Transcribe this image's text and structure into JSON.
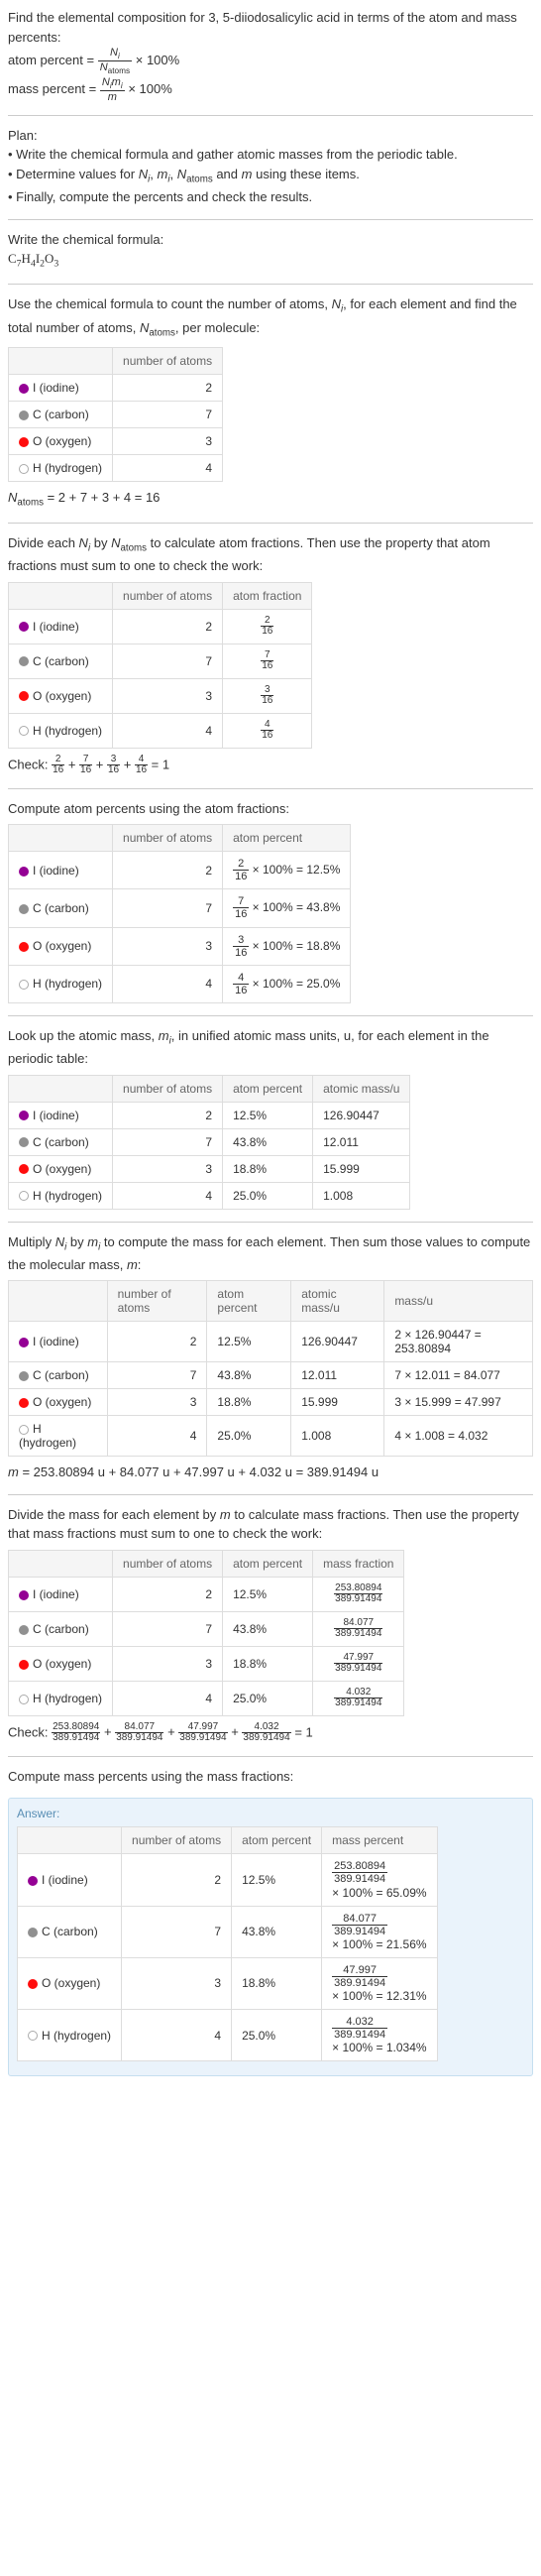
{
  "intro": {
    "title": "Find the elemental composition for 3, 5-diiodosalicylic acid in terms of the atom and mass percents:",
    "atom_percent_label": "atom percent =",
    "atom_percent_formula_num": "N_i",
    "atom_percent_formula_den": "N_atoms",
    "times100": "× 100%",
    "mass_percent_label": "mass percent =",
    "mass_percent_formula_num": "N_i m_i",
    "mass_percent_formula_den": "m"
  },
  "plan": {
    "heading": "Plan:",
    "b1": "• Write the chemical formula and gather atomic masses from the periodic table.",
    "b2_prefix": "• Determine values for ",
    "b2_terms": "N_i, m_i, N_atoms and m",
    "b2_suffix": " using these items.",
    "b3": "• Finally, compute the percents and check the results."
  },
  "formula_sec": {
    "heading": "Write the chemical formula:",
    "formula": "C₇H₄I₂O₃"
  },
  "count_sec": {
    "heading_pre": "Use the chemical formula to count the number of atoms, ",
    "heading_mid": ", for each element and find the total number of atoms, ",
    "heading_suf": ", per molecule:",
    "ni": "N_i",
    "natoms": "N_atoms",
    "col1": "",
    "col2": "number of atoms",
    "rows": [
      {
        "swatch": "iodine",
        "name": "I (iodine)",
        "n": "2"
      },
      {
        "swatch": "carbon",
        "name": "C (carbon)",
        "n": "7"
      },
      {
        "swatch": "oxygen",
        "name": "O (oxygen)",
        "n": "3"
      },
      {
        "swatch": "hydrogen",
        "name": "H (hydrogen)",
        "n": "4"
      }
    ],
    "total": "N_atoms = 2 + 7 + 3 + 4 = 16"
  },
  "atomfrac_sec": {
    "heading": "Divide each N_i by N_atoms to calculate atom fractions. Then use the property that atom fractions must sum to one to check the work:",
    "col2": "number of atoms",
    "col3": "atom fraction",
    "rows": [
      {
        "swatch": "iodine",
        "name": "I (iodine)",
        "n": "2",
        "fnum": "2",
        "fden": "16"
      },
      {
        "swatch": "carbon",
        "name": "C (carbon)",
        "n": "7",
        "fnum": "7",
        "fden": "16"
      },
      {
        "swatch": "oxygen",
        "name": "O (oxygen)",
        "n": "3",
        "fnum": "3",
        "fden": "16"
      },
      {
        "swatch": "hydrogen",
        "name": "H (hydrogen)",
        "n": "4",
        "fnum": "4",
        "fden": "16"
      }
    ],
    "check_label": "Check: ",
    "check_eq": "2/16 + 7/16 + 3/16 + 4/16 = 1"
  },
  "atompct_sec": {
    "heading": "Compute atom percents using the atom fractions:",
    "col2": "number of atoms",
    "col3": "atom percent",
    "rows": [
      {
        "swatch": "iodine",
        "name": "I (iodine)",
        "n": "2",
        "fnum": "2",
        "fden": "16",
        "pct": "12.5%"
      },
      {
        "swatch": "carbon",
        "name": "C (carbon)",
        "n": "7",
        "fnum": "7",
        "fden": "16",
        "pct": "43.8%"
      },
      {
        "swatch": "oxygen",
        "name": "O (oxygen)",
        "n": "3",
        "fnum": "3",
        "fden": "16",
        "pct": "18.8%"
      },
      {
        "swatch": "hydrogen",
        "name": "H (hydrogen)",
        "n": "4",
        "fnum": "4",
        "fden": "16",
        "pct": "25.0%"
      }
    ]
  },
  "atomicmass_sec": {
    "heading": "Look up the atomic mass, m_i, in unified atomic mass units, u, for each element in the periodic table:",
    "col2": "number of atoms",
    "col3": "atom percent",
    "col4": "atomic mass/u",
    "rows": [
      {
        "swatch": "iodine",
        "name": "I (iodine)",
        "n": "2",
        "pct": "12.5%",
        "mass": "126.90447"
      },
      {
        "swatch": "carbon",
        "name": "C (carbon)",
        "n": "7",
        "pct": "43.8%",
        "mass": "12.011"
      },
      {
        "swatch": "oxygen",
        "name": "O (oxygen)",
        "n": "3",
        "pct": "18.8%",
        "mass": "15.999"
      },
      {
        "swatch": "hydrogen",
        "name": "H (hydrogen)",
        "n": "4",
        "pct": "25.0%",
        "mass": "1.008"
      }
    ]
  },
  "molmass_sec": {
    "heading": "Multiply N_i by m_i to compute the mass for each element. Then sum those values to compute the molecular mass, m:",
    "col2": "number of atoms",
    "col3": "atom percent",
    "col4": "atomic mass/u",
    "col5": "mass/u",
    "rows": [
      {
        "swatch": "iodine",
        "name": "I (iodine)",
        "n": "2",
        "pct": "12.5%",
        "mass": "126.90447",
        "calc": "2 × 126.90447 = 253.80894"
      },
      {
        "swatch": "carbon",
        "name": "C (carbon)",
        "n": "7",
        "pct": "43.8%",
        "mass": "12.011",
        "calc": "7 × 12.011 = 84.077"
      },
      {
        "swatch": "oxygen",
        "name": "O (oxygen)",
        "n": "3",
        "pct": "18.8%",
        "mass": "15.999",
        "calc": "3 × 15.999 = 47.997"
      },
      {
        "swatch": "hydrogen",
        "name": "H (hydrogen)",
        "n": "4",
        "pct": "25.0%",
        "mass": "1.008",
        "calc": "4 × 1.008 = 4.032"
      }
    ],
    "total": "m = 253.80894 u + 84.077 u + 47.997 u + 4.032 u = 389.91494 u"
  },
  "massfrac_sec": {
    "heading": "Divide the mass for each element by m to calculate mass fractions. Then use the property that mass fractions must sum to one to check the work:",
    "col2": "number of atoms",
    "col3": "atom percent",
    "col4": "mass fraction",
    "rows": [
      {
        "swatch": "iodine",
        "name": "I (iodine)",
        "n": "2",
        "pct": "12.5%",
        "fnum": "253.80894",
        "fden": "389.91494"
      },
      {
        "swatch": "carbon",
        "name": "C (carbon)",
        "n": "7",
        "pct": "43.8%",
        "fnum": "84.077",
        "fden": "389.91494"
      },
      {
        "swatch": "oxygen",
        "name": "O (oxygen)",
        "n": "3",
        "pct": "18.8%",
        "fnum": "47.997",
        "fden": "389.91494"
      },
      {
        "swatch": "hydrogen",
        "name": "H (hydrogen)",
        "n": "4",
        "pct": "25.0%",
        "fnum": "4.032",
        "fden": "389.91494"
      }
    ],
    "check_label": "Check: ",
    "check_terms": [
      {
        "num": "253.80894",
        "den": "389.91494"
      },
      {
        "num": "84.077",
        "den": "389.91494"
      },
      {
        "num": "47.997",
        "den": "389.91494"
      },
      {
        "num": "4.032",
        "den": "389.91494"
      }
    ],
    "check_eq_suffix": " = 1"
  },
  "masspct_sec": {
    "heading": "Compute mass percents using the mass fractions:"
  },
  "answer": {
    "label": "Answer:",
    "col2": "number of atoms",
    "col3": "atom percent",
    "col4": "mass percent",
    "rows": [
      {
        "swatch": "iodine",
        "name": "I (iodine)",
        "n": "2",
        "pct": "12.5%",
        "fnum": "253.80894",
        "fden": "389.91494",
        "result": "× 100% = 65.09%"
      },
      {
        "swatch": "carbon",
        "name": "C (carbon)",
        "n": "7",
        "pct": "43.8%",
        "fnum": "84.077",
        "fden": "389.91494",
        "result": "× 100% = 21.56%"
      },
      {
        "swatch": "oxygen",
        "name": "O (oxygen)",
        "n": "3",
        "pct": "18.8%",
        "fnum": "47.997",
        "fden": "389.91494",
        "result": "× 100% = 12.31%"
      },
      {
        "swatch": "hydrogen",
        "name": "H (hydrogen)",
        "n": "4",
        "pct": "25.0%",
        "fnum": "4.032",
        "fden": "389.91494",
        "result": "× 100% = 1.034%"
      }
    ]
  }
}
